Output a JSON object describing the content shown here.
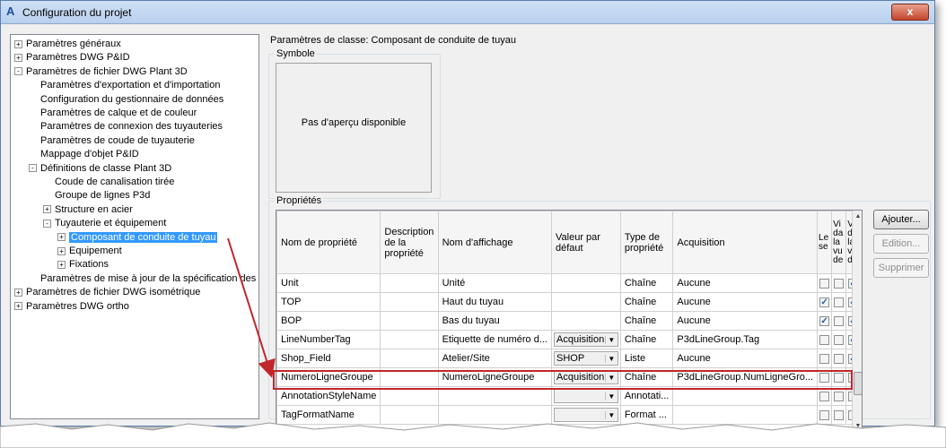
{
  "window": {
    "title": "Configuration du projet",
    "close_glyph": "x",
    "app_icon_letter": "A"
  },
  "tree": [
    {
      "label": "Paramètres généraux",
      "depth": 0,
      "expander": "+",
      "selected": false
    },
    {
      "label": "Paramètres DWG P&ID",
      "depth": 0,
      "expander": "+",
      "selected": false
    },
    {
      "label": "Paramètres de fichier DWG Plant 3D",
      "depth": 0,
      "expander": "-",
      "selected": false
    },
    {
      "label": "Paramètres d'exportation et d'importation",
      "depth": 1,
      "expander": "",
      "selected": false
    },
    {
      "label": "Configuration du gestionnaire de données",
      "depth": 1,
      "expander": "",
      "selected": false
    },
    {
      "label": "Paramètres de calque et de couleur",
      "depth": 1,
      "expander": "",
      "selected": false
    },
    {
      "label": "Paramètres de connexion des tuyauteries",
      "depth": 1,
      "expander": "",
      "selected": false
    },
    {
      "label": "Paramètres de coude de tuyauterie",
      "depth": 1,
      "expander": "",
      "selected": false
    },
    {
      "label": "Mappage d'objet P&ID",
      "depth": 1,
      "expander": "",
      "selected": false
    },
    {
      "label": "Définitions de classe Plant 3D",
      "depth": 1,
      "expander": "-",
      "selected": false
    },
    {
      "label": "Coude de canalisation tirée",
      "depth": 2,
      "expander": "",
      "selected": false
    },
    {
      "label": "Groupe de lignes P3d",
      "depth": 2,
      "expander": "",
      "selected": false
    },
    {
      "label": "Structure en acier",
      "depth": 2,
      "expander": "+",
      "selected": false
    },
    {
      "label": "Tuyauterie et équipement",
      "depth": 2,
      "expander": "-",
      "selected": false
    },
    {
      "label": "Composant de conduite de tuyau",
      "depth": 3,
      "expander": "+",
      "selected": true
    },
    {
      "label": "Equipement",
      "depth": 3,
      "expander": "+",
      "selected": false
    },
    {
      "label": "Fixations",
      "depth": 3,
      "expander": "+",
      "selected": false
    },
    {
      "label": "Paramètres de mise à jour de la spécification des tuy",
      "depth": 1,
      "expander": "",
      "selected": false
    },
    {
      "label": "Paramètres de fichier DWG isométrique",
      "depth": 0,
      "expander": "+",
      "selected": false
    },
    {
      "label": "Paramètres DWG ortho",
      "depth": 0,
      "expander": "+",
      "selected": false
    }
  ],
  "panel": {
    "class_title": "Paramètres de classe: Composant de conduite de tuyau",
    "symbol_label": "Symbole",
    "preview_text": "Pas d'aperçu disponible",
    "properties_label": "Propriétés"
  },
  "grid": {
    "columns": [
      "Nom de propriété",
      "Description de la propriété",
      "Nom d'affichage",
      "Valeur par défaut",
      "Type de propriété",
      "Acquisition",
      "Le se",
      "Vi da la vu de",
      "Vis da la vu d'c"
    ],
    "rows": [
      {
        "name": "Unit",
        "desc": "",
        "display": "Unité",
        "default": "",
        "combo": false,
        "type": "Chaîne",
        "acq": "Aucune",
        "c1": false,
        "c2": false,
        "c3": true
      },
      {
        "name": "TOP",
        "desc": "",
        "display": "Haut du tuyau",
        "default": "",
        "combo": false,
        "type": "Chaîne",
        "acq": "Aucune",
        "c1": true,
        "c2": false,
        "c3": true
      },
      {
        "name": "BOP",
        "desc": "",
        "display": "Bas du tuyau",
        "default": "",
        "combo": false,
        "type": "Chaîne",
        "acq": "Aucune",
        "c1": true,
        "c2": false,
        "c3": true
      },
      {
        "name": "LineNumberTag",
        "desc": "",
        "display": "Etiquette de numéro d...",
        "default": "Acquisition",
        "combo": true,
        "type": "Chaîne",
        "acq": "P3dLineGroup.Tag",
        "c1": false,
        "c2": false,
        "c3": true
      },
      {
        "name": "Shop_Field",
        "desc": "",
        "display": "Atelier/Site",
        "default": "SHOP",
        "combo": true,
        "type": "Liste",
        "acq": "Aucune",
        "c1": false,
        "c2": false,
        "c3": true
      },
      {
        "name": "NumeroLigneGroupe",
        "desc": "",
        "display": "NumeroLigneGroupe",
        "default": "Acquisition",
        "combo": true,
        "type": "Chaîne",
        "acq": "P3dLineGroup.NumLigneGro...",
        "c1": false,
        "c2": false,
        "c3": true
      },
      {
        "name": "AnnotationStyleName",
        "desc": "",
        "display": "",
        "default": "",
        "combo": true,
        "type": "Annotati...",
        "acq": "",
        "c1": false,
        "c2": false,
        "c3": false
      },
      {
        "name": "TagFormatName",
        "desc": "",
        "display": "",
        "default": "",
        "combo": true,
        "type": "Format ...",
        "acq": "",
        "c1": false,
        "c2": false,
        "c3": false
      }
    ]
  },
  "buttons": {
    "add": "Ajouter...",
    "edit": "Edition...",
    "delete": "Supprimer"
  },
  "colors": {
    "selection": "#3399ff",
    "highlight": "#c0272d"
  }
}
